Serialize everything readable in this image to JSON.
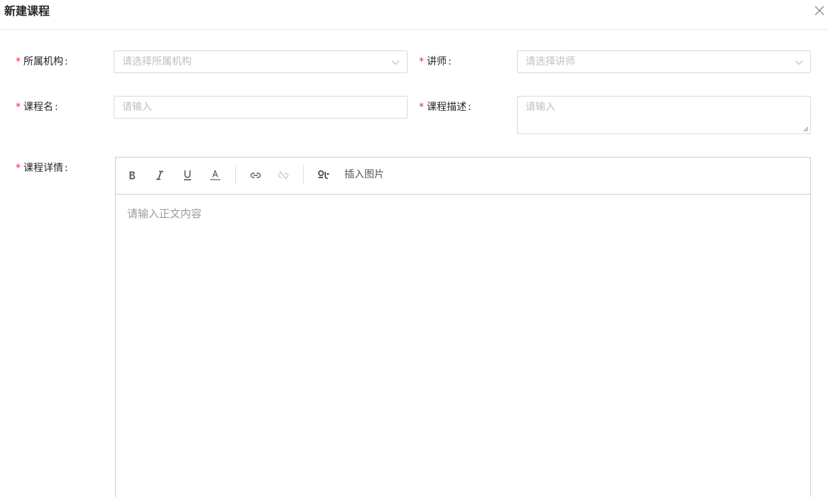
{
  "modal": {
    "title": "新建课程"
  },
  "form": {
    "institution": {
      "label": "所属机构",
      "placeholder": "请选择所属机构"
    },
    "lecturer": {
      "label": "讲师",
      "placeholder": "请选择讲师"
    },
    "course_name": {
      "label": "课程名",
      "placeholder": "请输入"
    },
    "course_description": {
      "label": "课程描述",
      "placeholder": "请输入"
    },
    "course_details": {
      "label": "课程详情",
      "editor_placeholder": "请输入正文内容",
      "toolbar": {
        "insert_image_label": "插入图片"
      }
    },
    "required_mark": "*",
    "colon": ":"
  },
  "icons": {
    "close": "close-icon",
    "dropdown": "chevron-down-icon",
    "bold": "bold-icon",
    "italic": "italic-icon",
    "underline": "underline-icon",
    "font_color": "font-color-icon",
    "link": "link-icon",
    "unlink": "unlink-icon",
    "image": "image-icon"
  },
  "colors": {
    "required": "#f5222d",
    "border": "#d9d9d9",
    "placeholder": "#bfbfbf"
  }
}
